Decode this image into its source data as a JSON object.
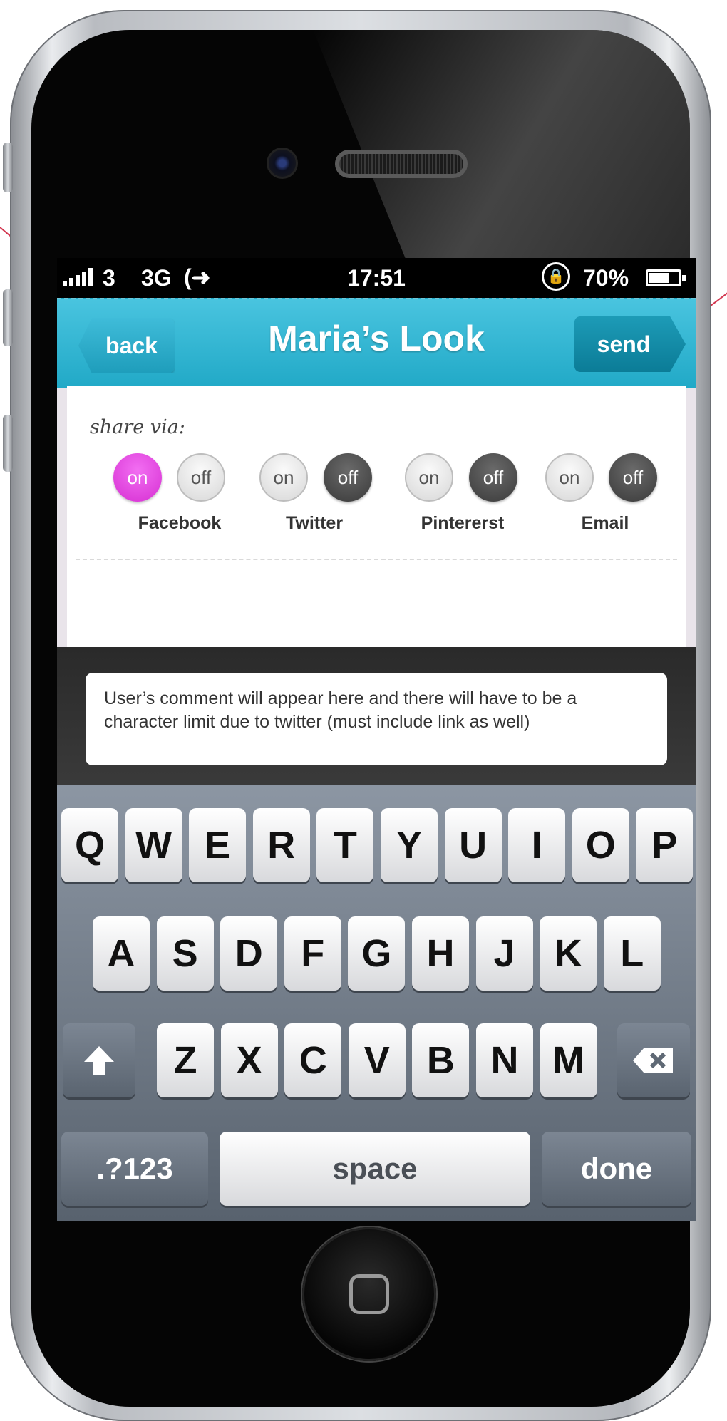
{
  "status_bar": {
    "carrier": "3",
    "network": "3G",
    "time": "17:51",
    "battery_percent": "70%",
    "battery_level": 0.7
  },
  "nav": {
    "back_label": "back",
    "title": "Maria’s Look",
    "send_label": "send"
  },
  "share": {
    "label": "share via:",
    "networks": [
      {
        "name": "Facebook",
        "on_label": "on",
        "off_label": "off",
        "state": "on"
      },
      {
        "name": "Twitter",
        "on_label": "on",
        "off_label": "off",
        "state": "off"
      },
      {
        "name": "Pintererst",
        "on_label": "on",
        "off_label": "off",
        "state": "off"
      },
      {
        "name": "Email",
        "on_label": "on",
        "off_label": "off",
        "state": "off"
      }
    ]
  },
  "comment": {
    "text": "User’s comment will appear here and there will have to be a character limit due to twitter (must include link as well)"
  },
  "keyboard": {
    "row1": [
      "Q",
      "W",
      "E",
      "R",
      "T",
      "Y",
      "U",
      "I",
      "O",
      "P"
    ],
    "row2": [
      "A",
      "S",
      "D",
      "F",
      "G",
      "H",
      "J",
      "K",
      "L"
    ],
    "row3": [
      "Z",
      "X",
      "C",
      "V",
      "B",
      "N",
      "M"
    ],
    "numbers_label": ".?123",
    "space_label": "space",
    "done_label": "done"
  },
  "colors": {
    "nav_bar": "#2fb6d3",
    "toggle_active": "#e04ae0",
    "annotation": "#d2364f"
  }
}
